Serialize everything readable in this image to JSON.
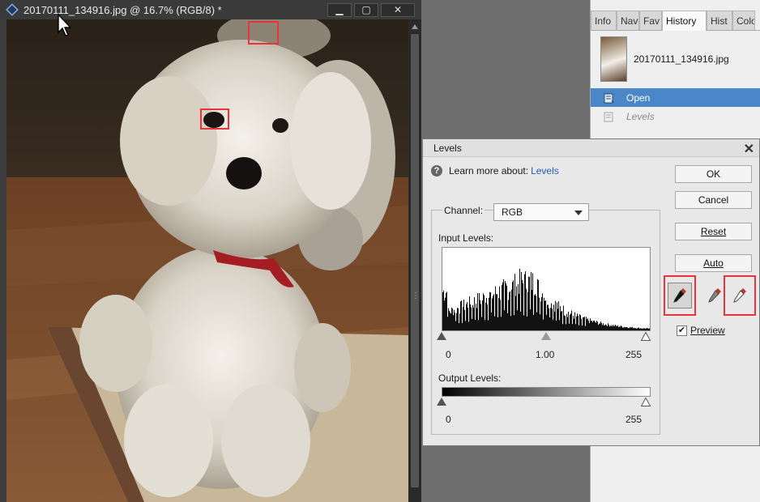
{
  "document": {
    "title": "20170111_134916.jpg @ 16.7% (RGB/8) *",
    "minimize_glyph": "▁",
    "maximize_glyph": "▢",
    "close_glyph": "✕"
  },
  "panel": {
    "tabs": [
      "Info",
      "Nav",
      "Fav",
      "History",
      "Hist",
      "Colo"
    ],
    "active_tab": "History",
    "snapshot_name": "20170111_134916.jpg",
    "history": [
      {
        "label": "Open",
        "state": "selected"
      },
      {
        "label": "Levels",
        "state": "inactive"
      }
    ]
  },
  "levels": {
    "title": "Levels",
    "close_glyph": "✕",
    "help_glyph": "?",
    "learn_more_text": "Learn more about:",
    "learn_more_link": "Levels",
    "channel_label": "Channel:",
    "channel_value": "RGB",
    "input_levels_label": "Input Levels:",
    "input_black": "0",
    "input_gamma": "1.00",
    "input_white": "255",
    "output_levels_label": "Output Levels:",
    "output_black": "0",
    "output_white": "255",
    "buttons": {
      "ok": "OK",
      "cancel": "Cancel",
      "reset": "Reset",
      "auto": "Auto"
    },
    "preview_label": "Preview",
    "preview_checked": true,
    "preview_check_glyph": "✔"
  },
  "colors": {
    "selection_blue": "#4a86c8",
    "marker_red": "#e8343a",
    "link_blue": "#1f5dbf"
  }
}
